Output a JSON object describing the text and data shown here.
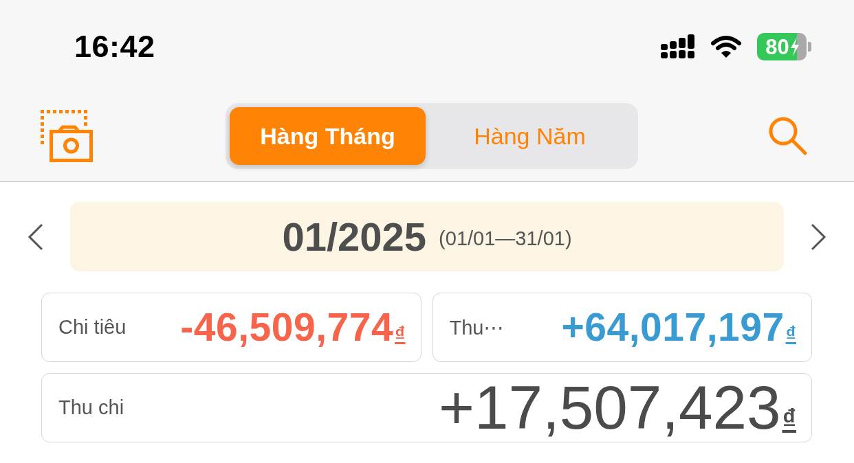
{
  "status_bar": {
    "time": "16:42",
    "battery": "80"
  },
  "toolbar": {
    "segments": [
      {
        "label": "Hàng Tháng",
        "selected": true
      },
      {
        "label": "Hàng Năm",
        "selected": false
      }
    ]
  },
  "period": {
    "month": "01/2025",
    "range": "(01/01—31/01)"
  },
  "totals": [
    {
      "label": "Chi tiêu",
      "amount": "-46,509,774",
      "currency": "₫",
      "color": "#f6644b"
    },
    {
      "label": "Thu⋯",
      "amount": "+64,017,197",
      "currency": "₫",
      "color": "#3a9bd3"
    }
  ],
  "balance": {
    "label": "Thu chi",
    "amount": "+17,507,423",
    "currency": "₫"
  }
}
